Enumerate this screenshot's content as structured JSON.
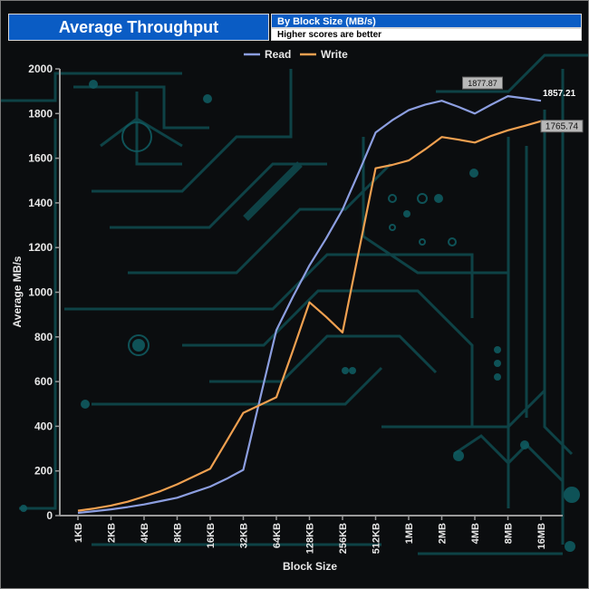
{
  "header": {
    "title": "Average Throughput",
    "subtitle": "By Block Size (MB/s)",
    "note": "Higher scores are better"
  },
  "colors": {
    "read": "#8c9ee0",
    "write": "#f0a050",
    "title_bg": "#0a5cc4",
    "circuit": "#0f4c50"
  },
  "chart_data": {
    "type": "line",
    "xlabel": "Block Size",
    "ylabel": "Average MB/s",
    "ylim": [
      0,
      2000
    ],
    "yticks": [
      0,
      200,
      400,
      600,
      800,
      1000,
      1200,
      1400,
      1600,
      1800,
      2000
    ],
    "categories": [
      "1KB",
      "2KB",
      "4KB",
      "8KB",
      "16KB",
      "32KB",
      "64KB",
      "128KB",
      "256KB",
      "512KB",
      "1MB",
      "2MB",
      "4MB",
      "8MB",
      "16MB"
    ],
    "x_points": [
      0,
      0.5,
      1,
      1.5,
      2,
      2.5,
      3,
      3.5,
      4,
      4.5,
      5,
      5.5,
      6,
      6.5,
      7,
      7.5,
      8,
      8.5,
      9,
      9.5,
      10,
      10.5,
      11,
      11.5,
      12,
      12.5,
      13,
      13.5,
      14
    ],
    "legend_position": "top",
    "grid": false,
    "series": [
      {
        "name": "Read",
        "values": [
          12,
          20,
          28,
          38,
          50,
          65,
          80,
          105,
          130,
          165,
          205,
          520,
          830,
          980,
          1120,
          1240,
          1370,
          1540,
          1715,
          1770,
          1815,
          1840,
          1857,
          1830,
          1800,
          1840,
          1878,
          1868,
          1857
        ],
        "end_label": "1857.21",
        "peak_label": "1877.87"
      },
      {
        "name": "Write",
        "values": [
          22,
          32,
          45,
          62,
          85,
          110,
          140,
          175,
          210,
          335,
          460,
          495,
          530,
          740,
          955,
          890,
          820,
          1190,
          1555,
          1570,
          1590,
          1640,
          1695,
          1683,
          1670,
          1700,
          1725,
          1745,
          1766
        ],
        "end_label": "1765.74"
      }
    ]
  }
}
